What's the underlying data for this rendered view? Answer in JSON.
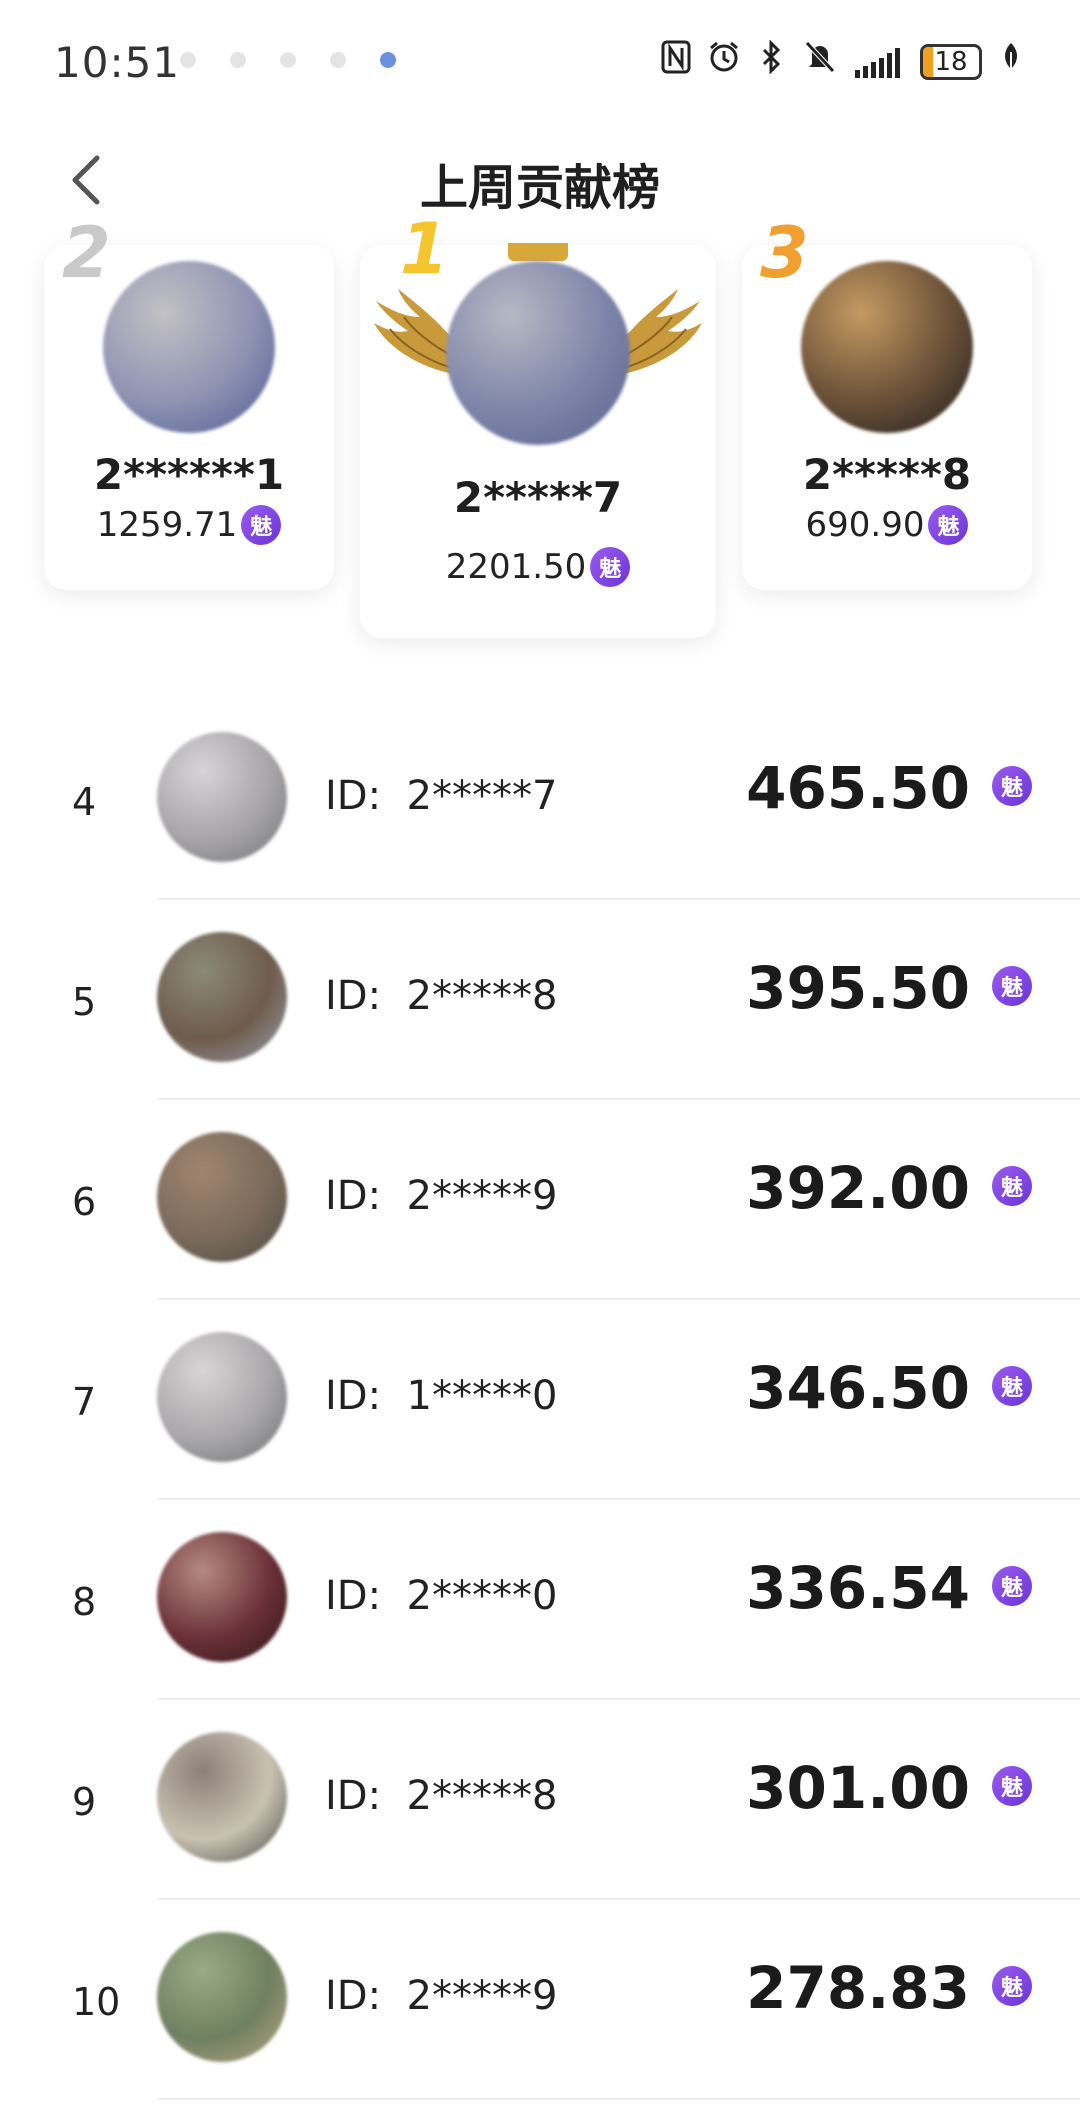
{
  "status_bar": {
    "time": "10:51",
    "battery_level": "18",
    "icons": [
      "nfc-icon",
      "alarm-icon",
      "bluetooth-icon",
      "mute-icon",
      "signal-icon",
      "battery-icon",
      "leaf-icon"
    ]
  },
  "header": {
    "title": "上周贡献榜",
    "back_icon": "chevron-left-icon"
  },
  "currency_badge": "魅",
  "podium": [
    {
      "rank": "1",
      "name": "2*****7",
      "score": "2201.50",
      "avatar_colors": [
        "#b7b9c4",
        "#7d84a8",
        "#5a6390"
      ]
    },
    {
      "rank": "2",
      "name": "2******1",
      "score": "1259.71",
      "avatar_colors": [
        "#c3c1c5",
        "#8e93b2",
        "#4f5a92"
      ]
    },
    {
      "rank": "3",
      "name": "2*****8",
      "score": "690.90",
      "avatar_colors": [
        "#c49a62",
        "#6a5038",
        "#1c1c1c"
      ]
    }
  ],
  "list": [
    {
      "rank": "4",
      "id_label": "ID:",
      "id": "2*****7",
      "score": "465.50",
      "avatar_colors": [
        "#d6d4d6",
        "#a8a5a9",
        "#6f7474"
      ]
    },
    {
      "rank": "5",
      "id_label": "ID:",
      "id": "2*****8",
      "score": "395.50",
      "avatar_colors": [
        "#8b8a7a",
        "#6e5c4c",
        "#9aa0b0"
      ]
    },
    {
      "rank": "6",
      "id_label": "ID:",
      "id": "2*****9",
      "score": "392.00",
      "avatar_colors": [
        "#a08570",
        "#7a6a5a",
        "#4a4a40"
      ]
    },
    {
      "rank": "7",
      "id_label": "ID:",
      "id": "1*****0",
      "score": "346.50",
      "avatar_colors": [
        "#d8d5d6",
        "#a9a7a9",
        "#6c6f70"
      ]
    },
    {
      "rank": "8",
      "id_label": "ID:",
      "id": "2*****0",
      "score": "336.54",
      "avatar_colors": [
        "#b58a82",
        "#6a3038",
        "#2b1418"
      ]
    },
    {
      "rank": "9",
      "id_label": "ID:",
      "id": "2*****8",
      "score": "301.00",
      "avatar_colors": [
        "#8c8078",
        "#c9c2b2",
        "#4a4844"
      ]
    },
    {
      "rank": "10",
      "id_label": "ID:",
      "id": "2*****9",
      "score": "278.83",
      "avatar_colors": [
        "#9aaa86",
        "#6f8060",
        "#c0a888"
      ]
    }
  ]
}
